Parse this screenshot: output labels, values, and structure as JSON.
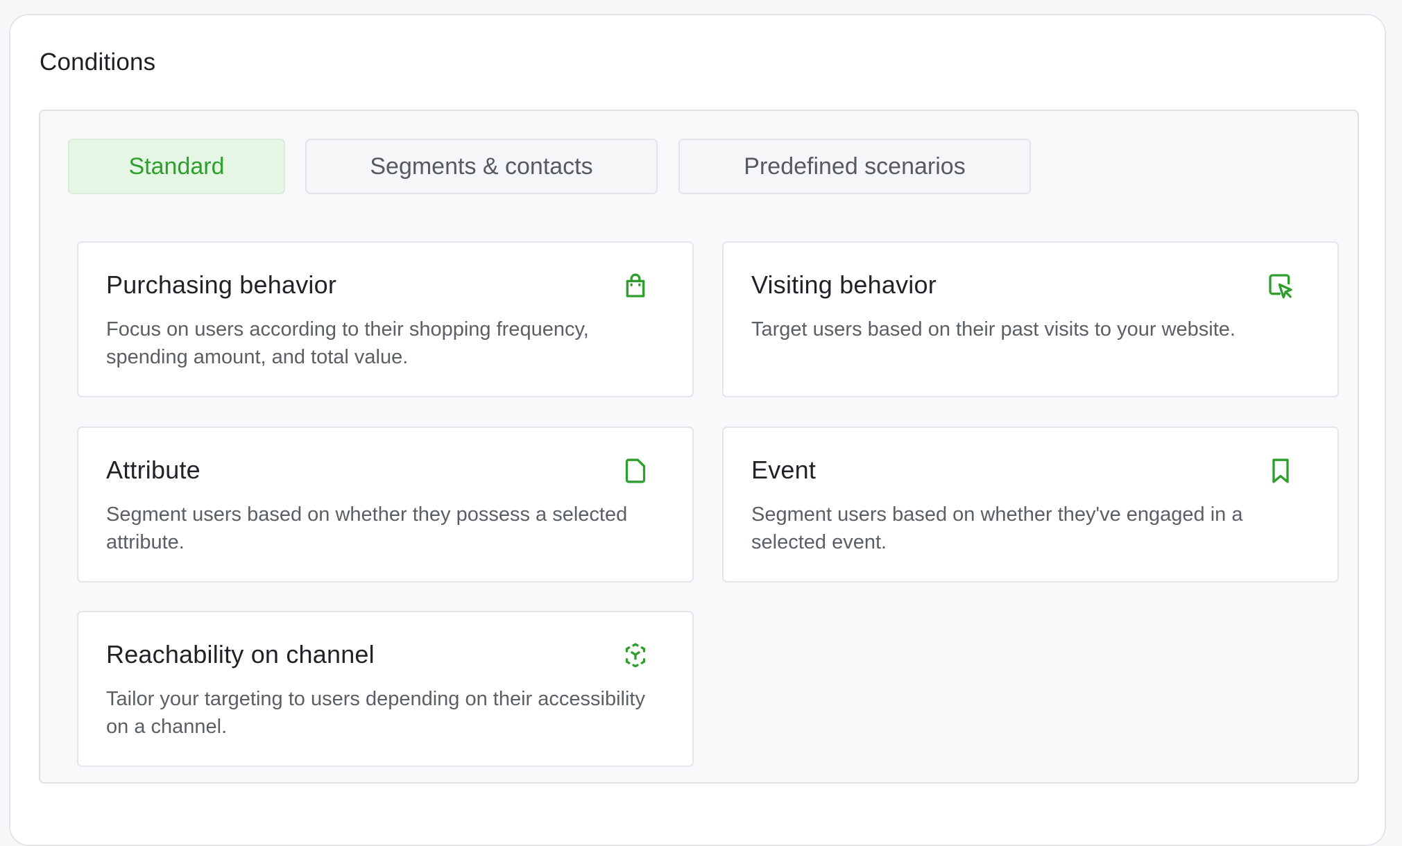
{
  "section": {
    "title": "Conditions"
  },
  "tabs": [
    {
      "label": "Standard",
      "active": true
    },
    {
      "label": "Segments & contacts",
      "active": false
    },
    {
      "label": "Predefined scenarios",
      "active": false
    }
  ],
  "options": [
    {
      "title": "Purchasing behavior",
      "description": "Focus on users according to their shopping frequency, spending amount, and total value.",
      "icon": "shopping-bag-icon"
    },
    {
      "title": "Visiting behavior",
      "description": "Target users based on their past visits to your website.",
      "icon": "cursor-click-icon"
    },
    {
      "title": "Attribute",
      "description": "Segment users based on whether they possess a selected attribute.",
      "icon": "document-icon"
    },
    {
      "title": "Event",
      "description": "Segment users based on whether they've engaged in a selected event.",
      "icon": "bookmark-icon"
    },
    {
      "title": "Reachability on channel",
      "description": "Tailor your targeting to users depending on their accessibility on a channel.",
      "icon": "dashed-cube-icon"
    }
  ],
  "colors": {
    "accent": "#2e9f2d",
    "active_tab_bg": "#e6f6e5"
  }
}
